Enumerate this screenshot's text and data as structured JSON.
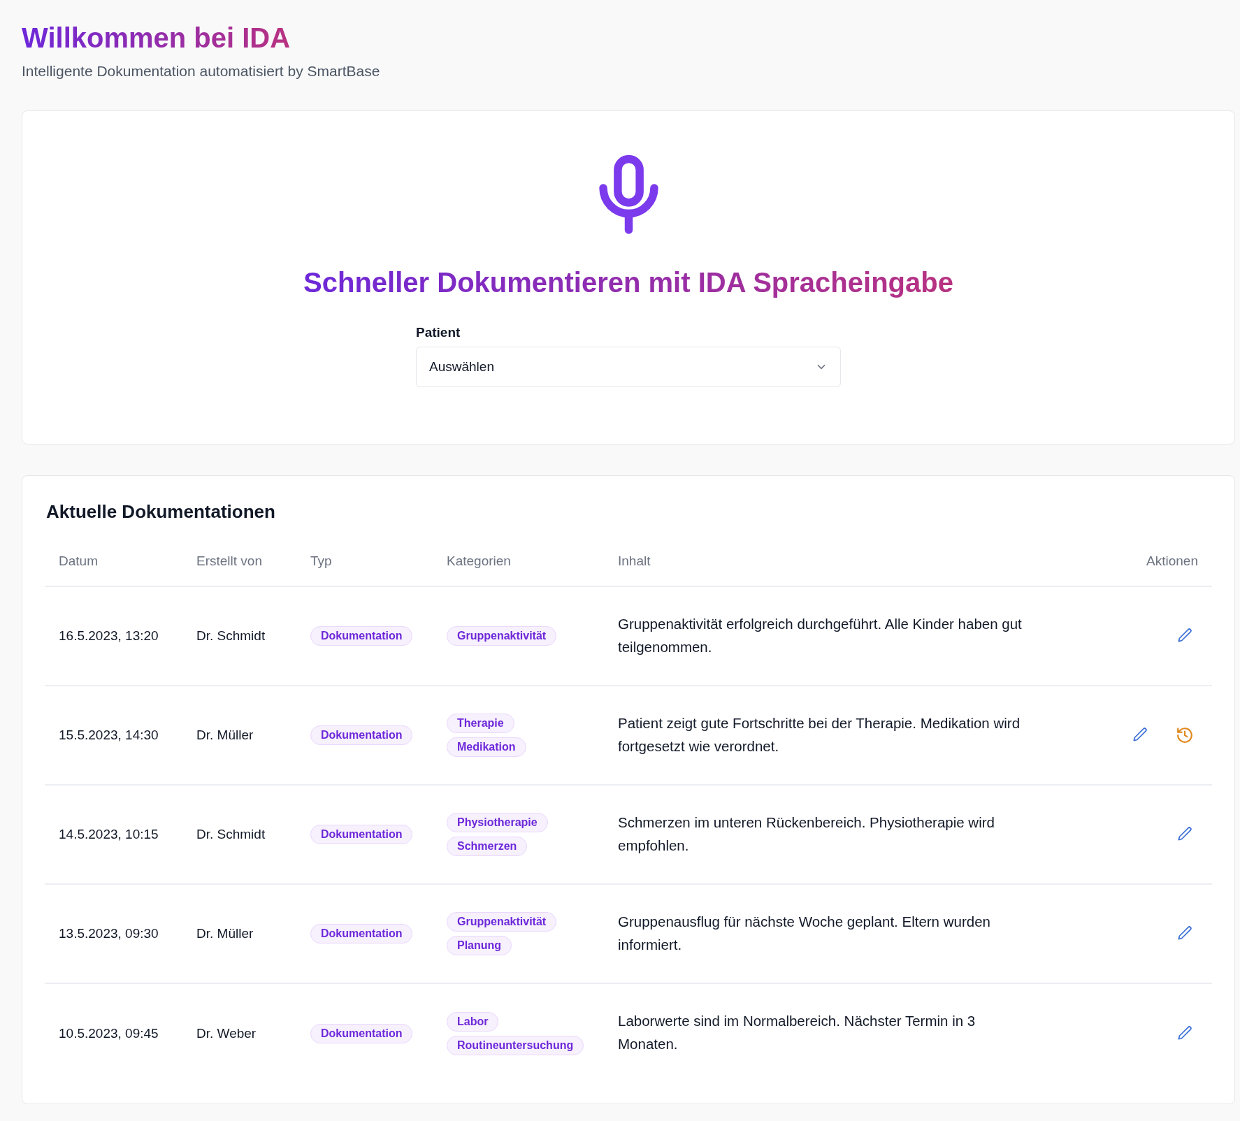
{
  "header": {
    "title": "Willkommen bei IDA",
    "subtitle": "Intelligente Dokumentation automatisiert by SmartBase"
  },
  "voice_card": {
    "heading": "Schneller Dokumentieren mit IDA Spracheingabe",
    "patient_label": "Patient",
    "patient_select": {
      "value": "Auswählen"
    }
  },
  "docs": {
    "heading": "Aktuelle Dokumentationen",
    "columns": [
      "Datum",
      "Erstellt von",
      "Typ",
      "Kategorien",
      "Inhalt",
      "Aktionen"
    ],
    "rows": [
      {
        "date": "16.5.2023, 13:20",
        "author": "Dr. Schmidt",
        "type": "Dokumentation",
        "categories": [
          "Gruppenaktivität"
        ],
        "content": "Gruppenaktivität erfolgreich durchgeführt. Alle Kinder haben gut teilgenommen.",
        "actions": [
          {
            "kind": "edit"
          }
        ]
      },
      {
        "date": "15.5.2023, 14:30",
        "author": "Dr. Müller",
        "type": "Dokumentation",
        "categories": [
          "Therapie",
          "Medikation"
        ],
        "content": "Patient zeigt gute Fortschritte bei der Therapie. Medikation wird fortgesetzt wie verordnet.",
        "actions": [
          {
            "kind": "edit"
          },
          {
            "kind": "history"
          }
        ]
      },
      {
        "date": "14.5.2023, 10:15",
        "author": "Dr. Schmidt",
        "type": "Dokumentation",
        "categories": [
          "Physiotherapie",
          "Schmerzen"
        ],
        "content": "Schmerzen im unteren Rückenbereich. Physiotherapie wird empfohlen.",
        "actions": [
          {
            "kind": "edit"
          }
        ]
      },
      {
        "date": "13.5.2023, 09:30",
        "author": "Dr. Müller",
        "type": "Dokumentation",
        "categories": [
          "Gruppenaktivität",
          "Planung"
        ],
        "content": "Gruppenausflug für nächste Woche geplant. Eltern wurden informiert.",
        "actions": [
          {
            "kind": "edit"
          }
        ]
      },
      {
        "date": "10.5.2023, 09:45",
        "author": "Dr. Weber",
        "type": "Dokumentation",
        "categories": [
          "Labor",
          "Routineuntersuchung"
        ],
        "content": "Laborwerte sind im Normalbereich. Nächster Termin in 3 Monaten.",
        "actions": [
          {
            "kind": "edit"
          }
        ]
      }
    ]
  }
}
